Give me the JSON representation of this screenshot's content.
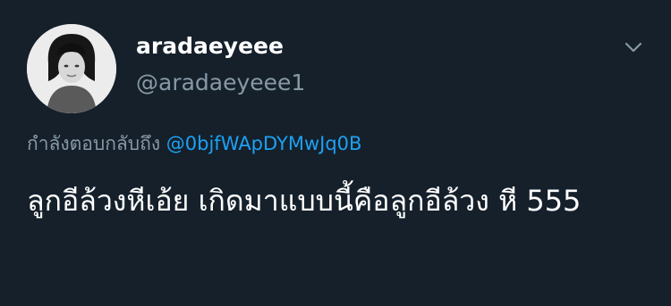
{
  "tweet": {
    "display_name": "aradaeyeee",
    "handle": "@aradaeyeee1",
    "reply_prefix": "กำลังตอบกลับถึง",
    "reply_mention": "@0bjfWApDYMwJq0B",
    "text": "ลูกอีล้วงหีเอ้ย เกิดมาแบบนี้คือลูกอีล้วง หี 555",
    "avatar_icon": "profile-photo",
    "more_icon": "chevron-down-icon"
  },
  "colors": {
    "background": "#15202b",
    "primary_text": "#ffffff",
    "secondary_text": "#8899a6",
    "accent": "#1da1f2"
  }
}
